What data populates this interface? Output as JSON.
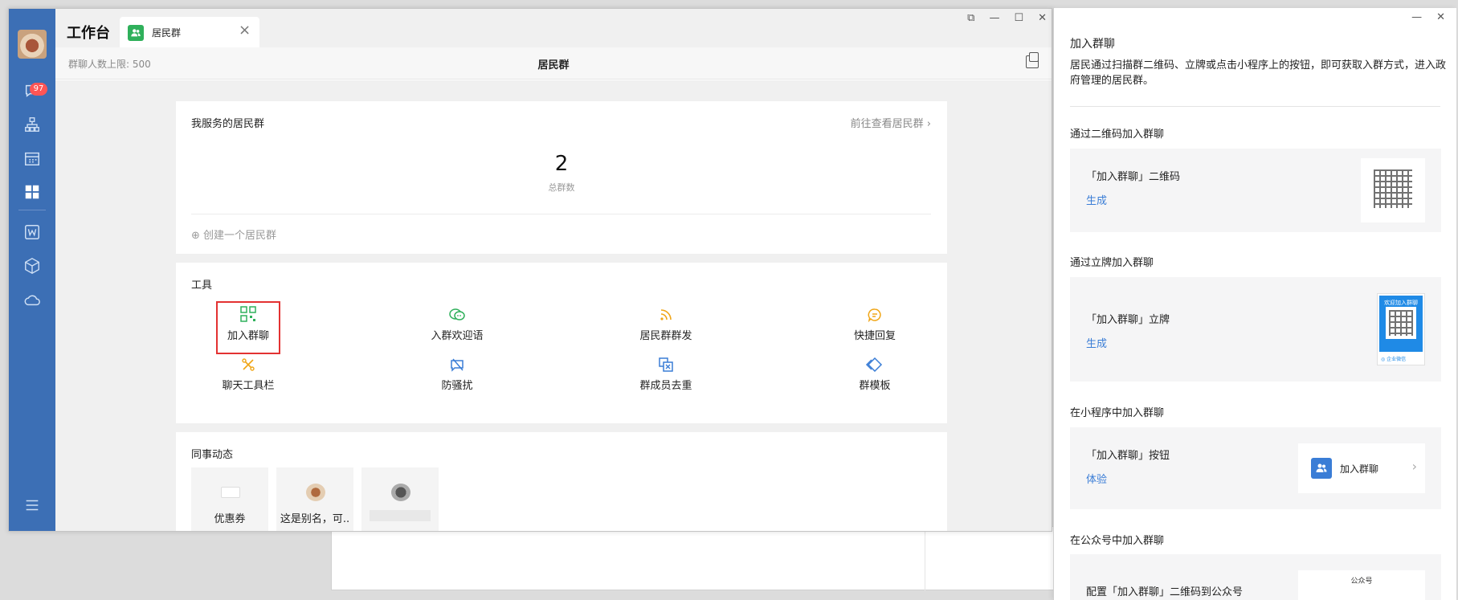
{
  "main": {
    "workbench_title": "工作台",
    "tab": {
      "label": "居民群"
    },
    "window_controls": [
      "⧉",
      "—",
      "☐",
      "✕"
    ],
    "subbar": {
      "limit": "群聊人数上限: 500",
      "title": "居民群"
    }
  },
  "sidebar": {
    "unread_badge": "97"
  },
  "my_groups": {
    "title": "我服务的居民群",
    "goto": "前往查看居民群",
    "count": "2",
    "count_label": "总群数",
    "create": "创建一个居民群"
  },
  "tools": {
    "title": "工具",
    "items": [
      {
        "label": "加入群聊",
        "icon": "qrcode-icon",
        "color": "#2fb05b"
      },
      {
        "label": "入群欢迎语",
        "icon": "welcome-chat-icon",
        "color": "#2fb05b"
      },
      {
        "label": "居民群群发",
        "icon": "broadcast-icon",
        "color": "#f0a516"
      },
      {
        "label": "快捷回复",
        "icon": "quick-reply-icon",
        "color": "#f0a516"
      },
      {
        "label": "聊天工具栏",
        "icon": "toolbar-icon",
        "color": "#f0a516"
      },
      {
        "label": "防骚扰",
        "icon": "anti-harass-icon",
        "color": "#3a7dd6"
      },
      {
        "label": "群成员去重",
        "icon": "dedupe-icon",
        "color": "#3a7dd6"
      },
      {
        "label": "群模板",
        "icon": "template-icon",
        "color": "#3a7dd6"
      }
    ]
  },
  "colleague": {
    "title": "同事动态",
    "items": [
      {
        "label": "优惠券"
      },
      {
        "label": "这是别名，可.."
      },
      {
        "label": ""
      }
    ]
  },
  "panel": {
    "window_controls": [
      "—",
      "✕"
    ],
    "title": "加入群聊",
    "description": "居民通过扫描群二维码、立牌或点击小程序上的按钮，即可获取入群方式，进入政府管理的居民群。",
    "sections": [
      {
        "heading": "通过二维码加入群聊",
        "label": "「加入群聊」二维码",
        "action": "生成"
      },
      {
        "heading": "通过立牌加入群聊",
        "label": "「加入群聊」立牌",
        "action": "生成"
      },
      {
        "heading": "在小程序中加入群聊",
        "label": "「加入群聊」按钮",
        "action": "体验"
      },
      {
        "heading": "在公众号中加入群聊",
        "label": "配置「加入群聊」二维码到公众号",
        "action": ""
      }
    ],
    "stand_text": "欢迎加入群聊",
    "stand_footer": "◎ 企业微信",
    "button_preview_label": "加入群聊",
    "gzh_label": "公众号"
  },
  "colors": {
    "sidebar": "#3c6fb5",
    "accent": "#3a7dd6",
    "highlight": "#e33232",
    "green": "#2fb05b"
  }
}
